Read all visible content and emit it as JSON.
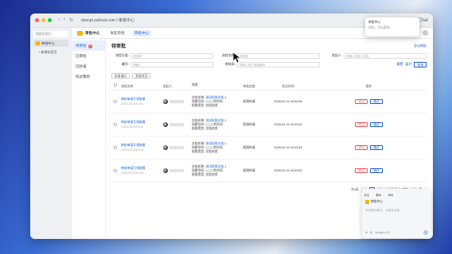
{
  "browser": {
    "url": "shenpi.zaihoai.com / 审批中心",
    "chat_label": "Chat"
  },
  "sidebar": {
    "search": "搜索标签页...",
    "items": [
      {
        "label": "审批中心"
      }
    ],
    "add": "+ 新建标签页"
  },
  "app": {
    "brand": "审批中心",
    "tabs": [
      "发起审批",
      "审批中心"
    ],
    "active_tab": 1,
    "right": [
      "审核管理中心",
      "设置"
    ]
  },
  "leftnav": [
    {
      "label": "待审批",
      "badge": "3"
    },
    {
      "label": "已审批"
    },
    {
      "label": "已抄送"
    },
    {
      "label": "科达我的"
    }
  ],
  "page": {
    "title": "待审批",
    "export": "导出审批"
  },
  "filters": {
    "row1": [
      {
        "label": "流程分类:",
        "placeholder": "请选择"
      },
      {
        "label": "流程名称:",
        "placeholder": "请选择"
      },
      {
        "label": "发起人:",
        "placeholder": "请输入发起人姓名"
      }
    ],
    "row2": [
      {
        "label": "编号:",
        "placeholder": "请输入"
      },
      {
        "label": "审核条:",
        "placeholder": "请输入用户或者编号"
      }
    ],
    "reset": "重置",
    "expand": "展开",
    "search": "查询"
  },
  "batch": [
    "批量通过",
    "批量驳回"
  ],
  "table": {
    "headers": [
      "流程名称",
      "发起人",
      "摘要",
      "审批进度",
      "到达时间",
      "操作"
    ],
    "rows": [
      {
        "name": "审核单填写领取模",
        "no": "2026022310001001",
        "doc_title": "文档名称:",
        "doc_link": "测试权限文档-4",
        "space": "所属空间:",
        "space_v": "的空间",
        "type": "权限类型:",
        "type_v": "文档浏览",
        "progress": "权限申请",
        "time": "2026-02-24 15:43:56",
        "reject": "驳回",
        "pass": "通过"
      },
      {
        "name": "审核单填写领取模",
        "no": "2026022310001002",
        "doc_title": "文档名称:",
        "doc_link": "测试权限文档-3",
        "space": "所属空间:",
        "space_v": "的空间",
        "type": "权限类型:",
        "type_v": "文档浏览",
        "progress": "权限申请",
        "time": "2026-02-24 15:43:51",
        "reject": "驳回",
        "pass": "通过"
      },
      {
        "name": "审核单填写领取模",
        "no": "2026022310001003",
        "doc_title": "文档名称:",
        "doc_link": "测试权限文档-2",
        "space": "所属空间:",
        "space_v": "的空间",
        "type": "权限类型:",
        "type_v": "文档浏览",
        "progress": "权限申请",
        "time": "2026-02-24 15:43:46",
        "reject": "驳回",
        "pass": "通过"
      },
      {
        "name": "审核单填写领取模",
        "no": "2026022310001004",
        "doc_title": "文档名称:",
        "doc_link": "测试权限文档-1",
        "space": "所属空间:",
        "space_v": "的空间",
        "type": "权限类型:",
        "type_v": "文档浏览",
        "progress": "权限申请",
        "time": "2026-02-24 15:43:40",
        "reject": "驳回",
        "pass": "通过"
      }
    ]
  },
  "pager": {
    "total": "共4条",
    "page": "1",
    "size": "20条/页",
    "goto": "前往",
    "page_input": "1",
    "page_unit": "页"
  },
  "chat": {
    "tags": [
      "总结",
      "翻译",
      "润色"
    ],
    "head": "审批中心",
    "placeholder": "有问题尽管问，@插件技能",
    "foot": "Autoglm-4.5"
  },
  "popup": {
    "title": "审批中心",
    "text": "你好，可以帮你..."
  },
  "colors": {
    "accent": "#1a5fd6",
    "danger": "#e55",
    "brand": "#f5b400"
  }
}
